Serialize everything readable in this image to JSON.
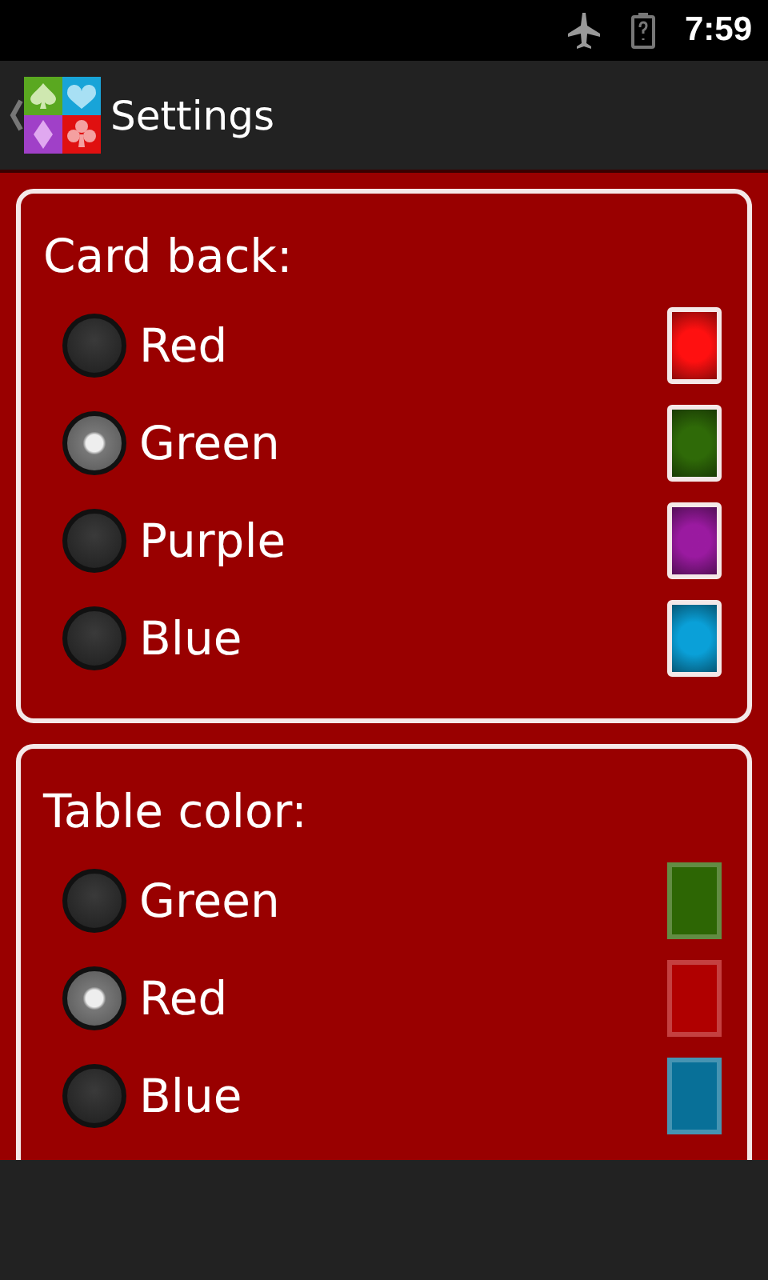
{
  "status_bar": {
    "time": "7:59"
  },
  "action_bar": {
    "title": "Settings"
  },
  "groups": [
    {
      "title": "Card back:",
      "kind": "card",
      "options": [
        {
          "label": "Red",
          "selected": false,
          "color": "#ff1010"
        },
        {
          "label": "Green",
          "selected": true,
          "color": "#2f6a08"
        },
        {
          "label": "Purple",
          "selected": false,
          "color": "#9a1aa0"
        },
        {
          "label": "Blue",
          "selected": false,
          "color": "#0aa0d8"
        }
      ]
    },
    {
      "title": "Table color:",
      "kind": "table",
      "options": [
        {
          "label": "Green",
          "selected": false,
          "color": "#2d6604"
        },
        {
          "label": "Red",
          "selected": true,
          "color": "#b00000"
        },
        {
          "label": "Blue",
          "selected": false,
          "color": "#087098"
        }
      ]
    }
  ]
}
